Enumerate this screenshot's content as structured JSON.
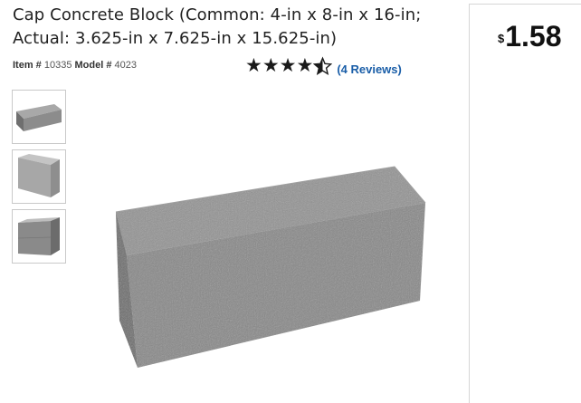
{
  "product": {
    "title": "Cap Concrete Block (Common: 4-in x 8-in x 16-in; Actual: 3.625-in x 7.625-in x 15.625-in)",
    "item_label": "Item #",
    "item_number": "10335",
    "model_label": "Model #",
    "model_number": "4023",
    "rating": 4.5,
    "reviews_text": "(4 Reviews)"
  },
  "price": {
    "currency": "$",
    "amount": "1.58"
  },
  "gallery": {
    "thumbnails": [
      "block-front-view",
      "block-angle-view",
      "block-stacked-view"
    ]
  },
  "colors": {
    "link": "#1a5ea8",
    "stars": "#1a1a1a",
    "block": "#8a8a8a"
  }
}
